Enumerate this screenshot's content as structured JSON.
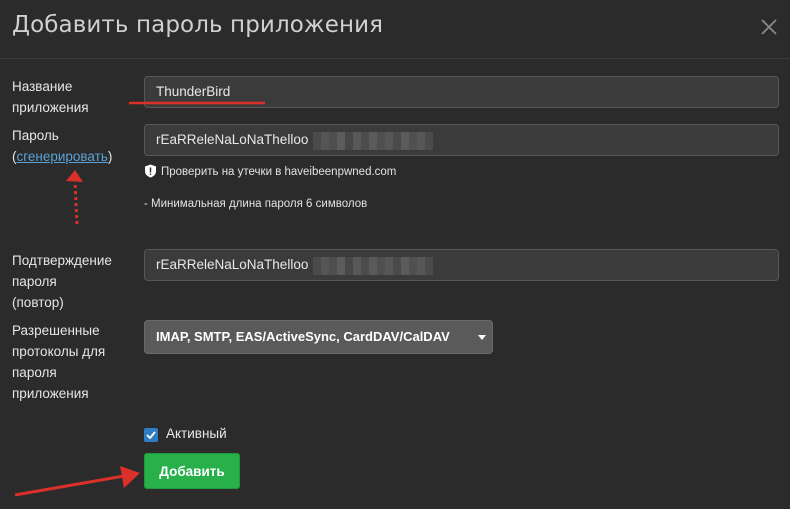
{
  "dialog": {
    "title": "Добавить пароль приложения",
    "close_icon": "close-icon"
  },
  "form": {
    "app_name": {
      "label_line1": "Название",
      "label_line2": "приложения",
      "value": "ThunderBird"
    },
    "password": {
      "label": "Пароль",
      "paren_open": "(",
      "generate_link": "сгенерировать",
      "paren_close": ")",
      "value": "rEaRReleNaLoNaThelloo",
      "leak_check": "Проверить на утечки в haveibeenpwned.com",
      "min_length_note": "- Минимальная длина пароля 6 символов"
    },
    "confirm": {
      "label_line1": "Подтверждение",
      "label_line2": "пароля",
      "label_line3": "(повтор)",
      "value": "rEaRReleNaLoNaThelloo"
    },
    "protocols": {
      "label_line1": "Разрешенные",
      "label_line2": "протоколы для",
      "label_line3": "пароля",
      "label_line4": "приложения",
      "selected": "IMAP, SMTP, EAS/ActiveSync, CardDAV/CalDAV"
    },
    "active": {
      "label": "Активный",
      "checked": true
    },
    "submit_label": "Добавить"
  },
  "colors": {
    "background": "#2b2b2b",
    "accent_green": "#28b04a",
    "link_blue": "#5aa2d6",
    "annotation_red": "#d9302a",
    "checkbox_blue": "#2f7ec4"
  }
}
